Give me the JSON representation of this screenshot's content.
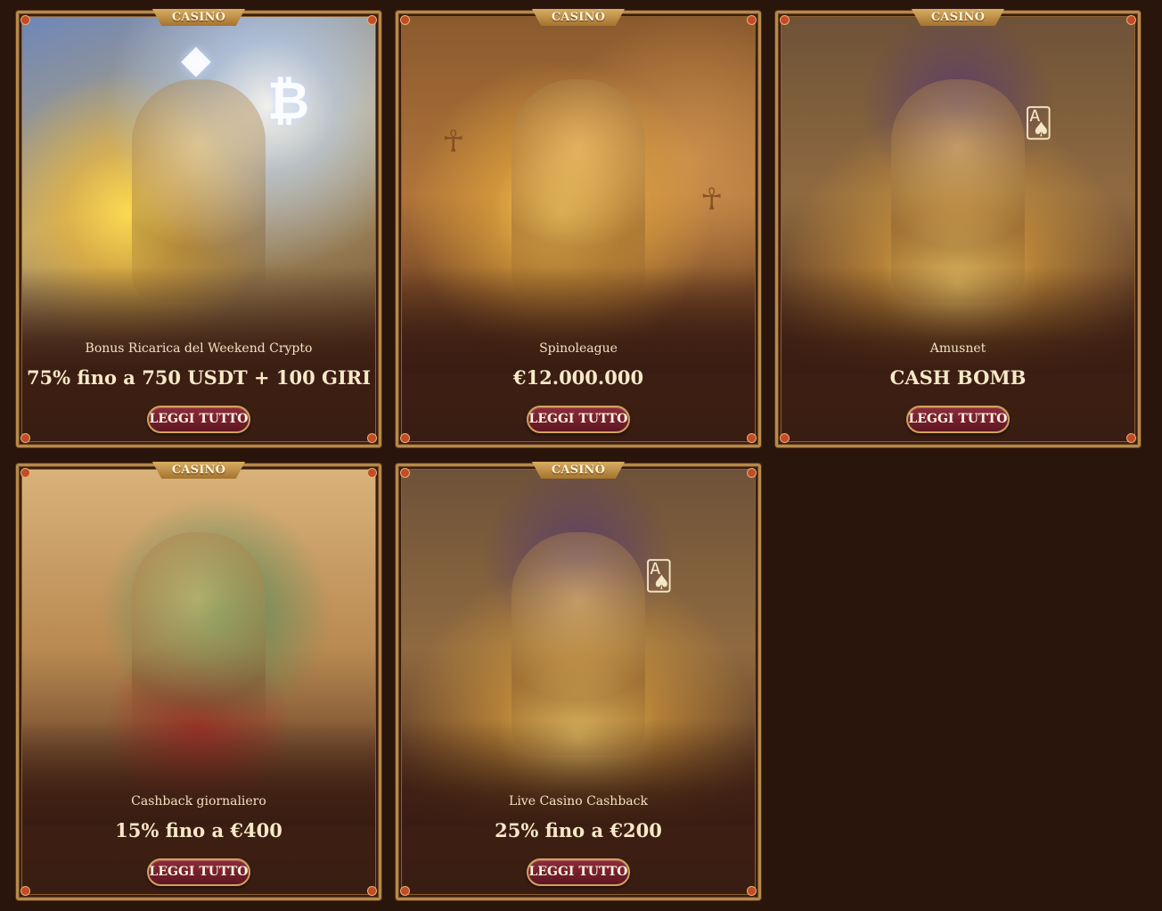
{
  "colors": {
    "page_background": "#2a150c",
    "card_frame": "#b58a4a",
    "button_fill": "#7a2230",
    "accent_gold": "#d7ad62"
  },
  "cards": [
    {
      "tag": "CASINÒ",
      "subtitle": "Bonus Ricarica del Weekend Crypto",
      "headline": "75% fino a 750 USDT + 100 GIRI",
      "button": "LEGGI TUTTO",
      "art": "golden-winged-pharaoh-with-crypto-coins"
    },
    {
      "tag": "CASINÒ",
      "subtitle": "Spinoleague",
      "headline": "€12.000.000",
      "button": "LEGGI TUTTO",
      "art": "cat-goddess-riding-golden-lioness"
    },
    {
      "tag": "CASINÒ",
      "subtitle": "Amusnet",
      "headline": "CASH BOMB",
      "button": "LEGGI TUTTO",
      "art": "anubis-with-cards-and-treasure"
    },
    {
      "tag": "CASINÒ",
      "subtitle": "Cashback giornaliero",
      "headline": "15% fino a €400",
      "button": "LEGGI TUTTO",
      "art": "crocodile-god-with-gold-coins"
    },
    {
      "tag": "CASINÒ",
      "subtitle": "Live Casino Cashback",
      "headline": "25% fino a €200",
      "button": "LEGGI TUTTO",
      "art": "anubis-with-cards-and-treasure"
    }
  ]
}
